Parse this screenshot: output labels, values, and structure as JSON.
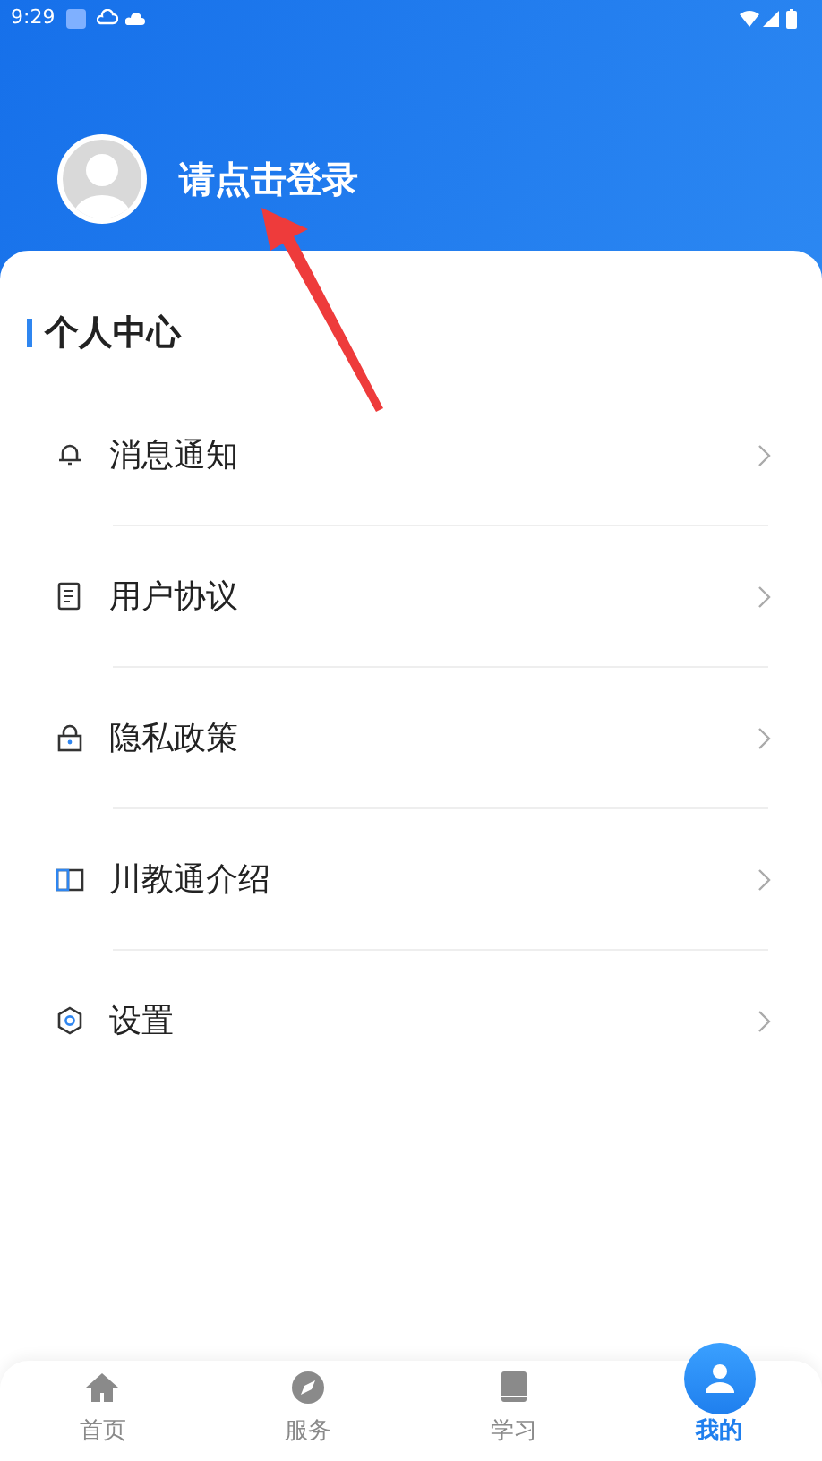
{
  "status_bar": {
    "time": "9:29"
  },
  "profile": {
    "login_prompt": "请点击登录"
  },
  "section_title": "个人中心",
  "menu": [
    {
      "kind": "bell",
      "label": "消息通知"
    },
    {
      "kind": "document",
      "label": "用户协议"
    },
    {
      "kind": "lock",
      "label": "隐私政策"
    },
    {
      "kind": "book",
      "label": "川教通介绍"
    },
    {
      "kind": "gear",
      "label": "设置"
    }
  ],
  "tabs": [
    {
      "kind": "home",
      "label": "首页",
      "selected": false
    },
    {
      "kind": "compass",
      "label": "服务",
      "selected": false
    },
    {
      "kind": "book",
      "label": "学习",
      "selected": false
    },
    {
      "kind": "person",
      "label": "我的",
      "selected": true
    }
  ]
}
